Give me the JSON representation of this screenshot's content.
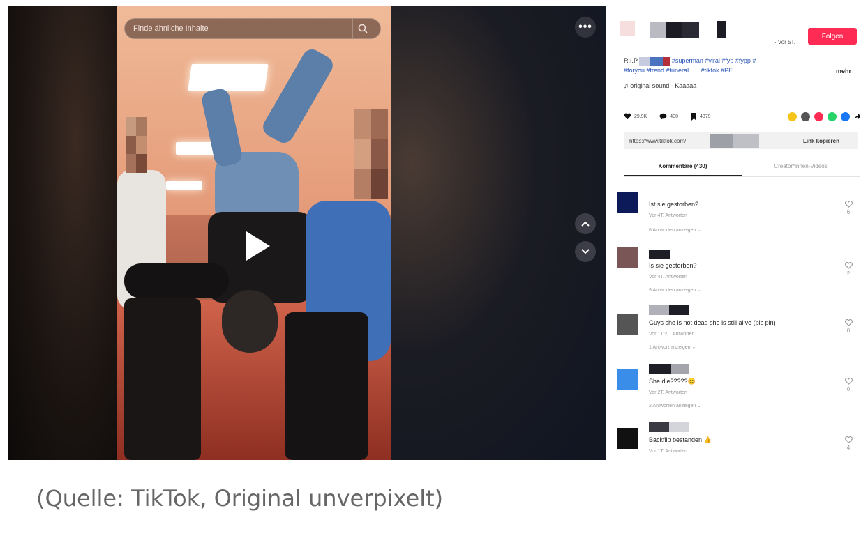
{
  "video": {
    "search_placeholder": "Finde ähnliche Inhalte",
    "more_label": "•••"
  },
  "side_panel": {
    "author_time": "· Vor 5T.",
    "follow_label": "Folgen",
    "caption": {
      "prefix": "R.I.P",
      "tags_line1": "#superman #viral #fyp #fypp #",
      "tags_line2": "#foryou #trend #funeral",
      "tags_line2b": "#tiktok #PE...",
      "more_label": "mehr"
    },
    "sound": "♫ original sound - Kaaaaa",
    "stats": {
      "likes": "29.9K",
      "comments": "430",
      "saves": "4379"
    },
    "share_colors": [
      "#f5c518",
      "#555555",
      "#fe2c55",
      "#25d366",
      "#1877f2"
    ],
    "link": {
      "url": "https://www.tiktok.com/",
      "copy_label": "Link kopieren"
    },
    "tabs": [
      "Kommentare (430)",
      "Creator*innen-Videos"
    ],
    "comments": [
      {
        "text": "Ist sie gestorben?",
        "meta": "Vor 4T.     Antworten",
        "replies": "6 Antworten anzeigen ⌄",
        "likes": "6",
        "avatar": "#0c1a5a"
      },
      {
        "text": "Is sie gestorben?",
        "meta": "Vor 4T.     Antworten",
        "replies": "9 Antworten anzeigen ⌄",
        "likes": "2",
        "avatar": "#7a5656"
      },
      {
        "text": "Guys she is not dead she is still alive (pls pin)",
        "meta": "Vor 1Tt2...  Antworten",
        "replies": "1 Antwort anzeigen ⌄",
        "likes": "0",
        "avatar": "#555555"
      },
      {
        "text": "She die?????😊",
        "meta": "Vor 2T.     Antworten",
        "replies": "2 Antworten anzeigen ⌄",
        "likes": "0",
        "avatar": "#3a8eea"
      },
      {
        "text": "Backflip bestanden 👍",
        "meta": "Vor 1T.     Antworten",
        "replies": "",
        "likes": "4",
        "avatar": "#111111"
      }
    ]
  },
  "footer_caption": "(Quelle: TikTok, Original unverpixelt)"
}
